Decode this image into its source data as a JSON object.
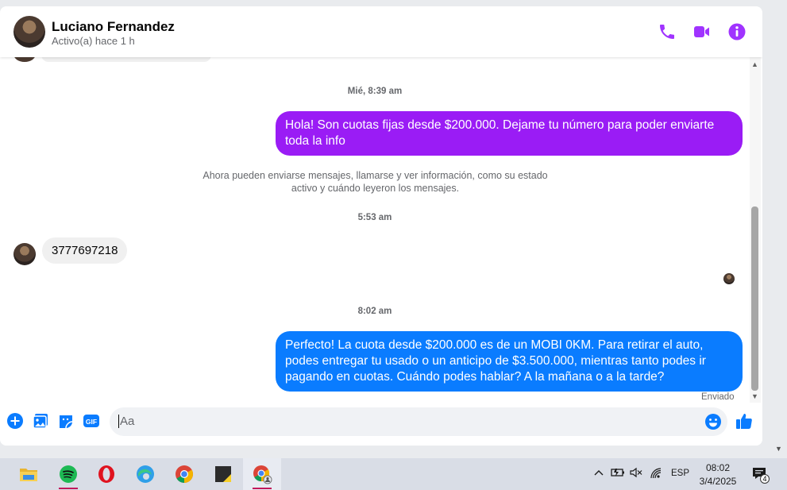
{
  "header": {
    "name": "Luciano Fernandez",
    "status": "Activo(a) hace 1 h",
    "icons": [
      "phone-icon",
      "video-icon",
      "info-icon"
    ],
    "accent_color": "#a033ff"
  },
  "messages": {
    "timestamp_1": "Mié, 8:39 am",
    "out_1": "Hola! Son cuotas fijas desde $200.000. Dejame tu número para poder enviarte toda la info",
    "notice": "Ahora pueden enviarse mensajes, llamarse y ver información, como su estado activo y cuándo leyeron los mensajes.",
    "timestamp_2": "5:53 am",
    "in_1": "3777697218",
    "timestamp_3": "8:02 am",
    "out_2": "Perfecto! La cuota desde $200.000 es de un MOBI 0KM. Para retirar el auto, podes entregar tu usado o un anticipo de $3.500.000, mientras tanto podes ir pagando en cuotas. Cuándo podes hablar? A la mañana o a la tarde?",
    "sent_status": "Enviado",
    "out_1_color": "#9a1cf5",
    "out_2_color": "#0a7cff"
  },
  "composer": {
    "placeholder": "Aa",
    "gif_label": "GIF"
  },
  "taskbar": {
    "apps": [
      "file-explorer-icon",
      "spotify-icon",
      "opera-icon",
      "edge-icon",
      "chrome-icon",
      "sticky-notes-icon",
      "chrome-profile-icon"
    ],
    "language": "ESP",
    "time": "08:02",
    "date": "3/4/2025",
    "notification_count": "4"
  }
}
